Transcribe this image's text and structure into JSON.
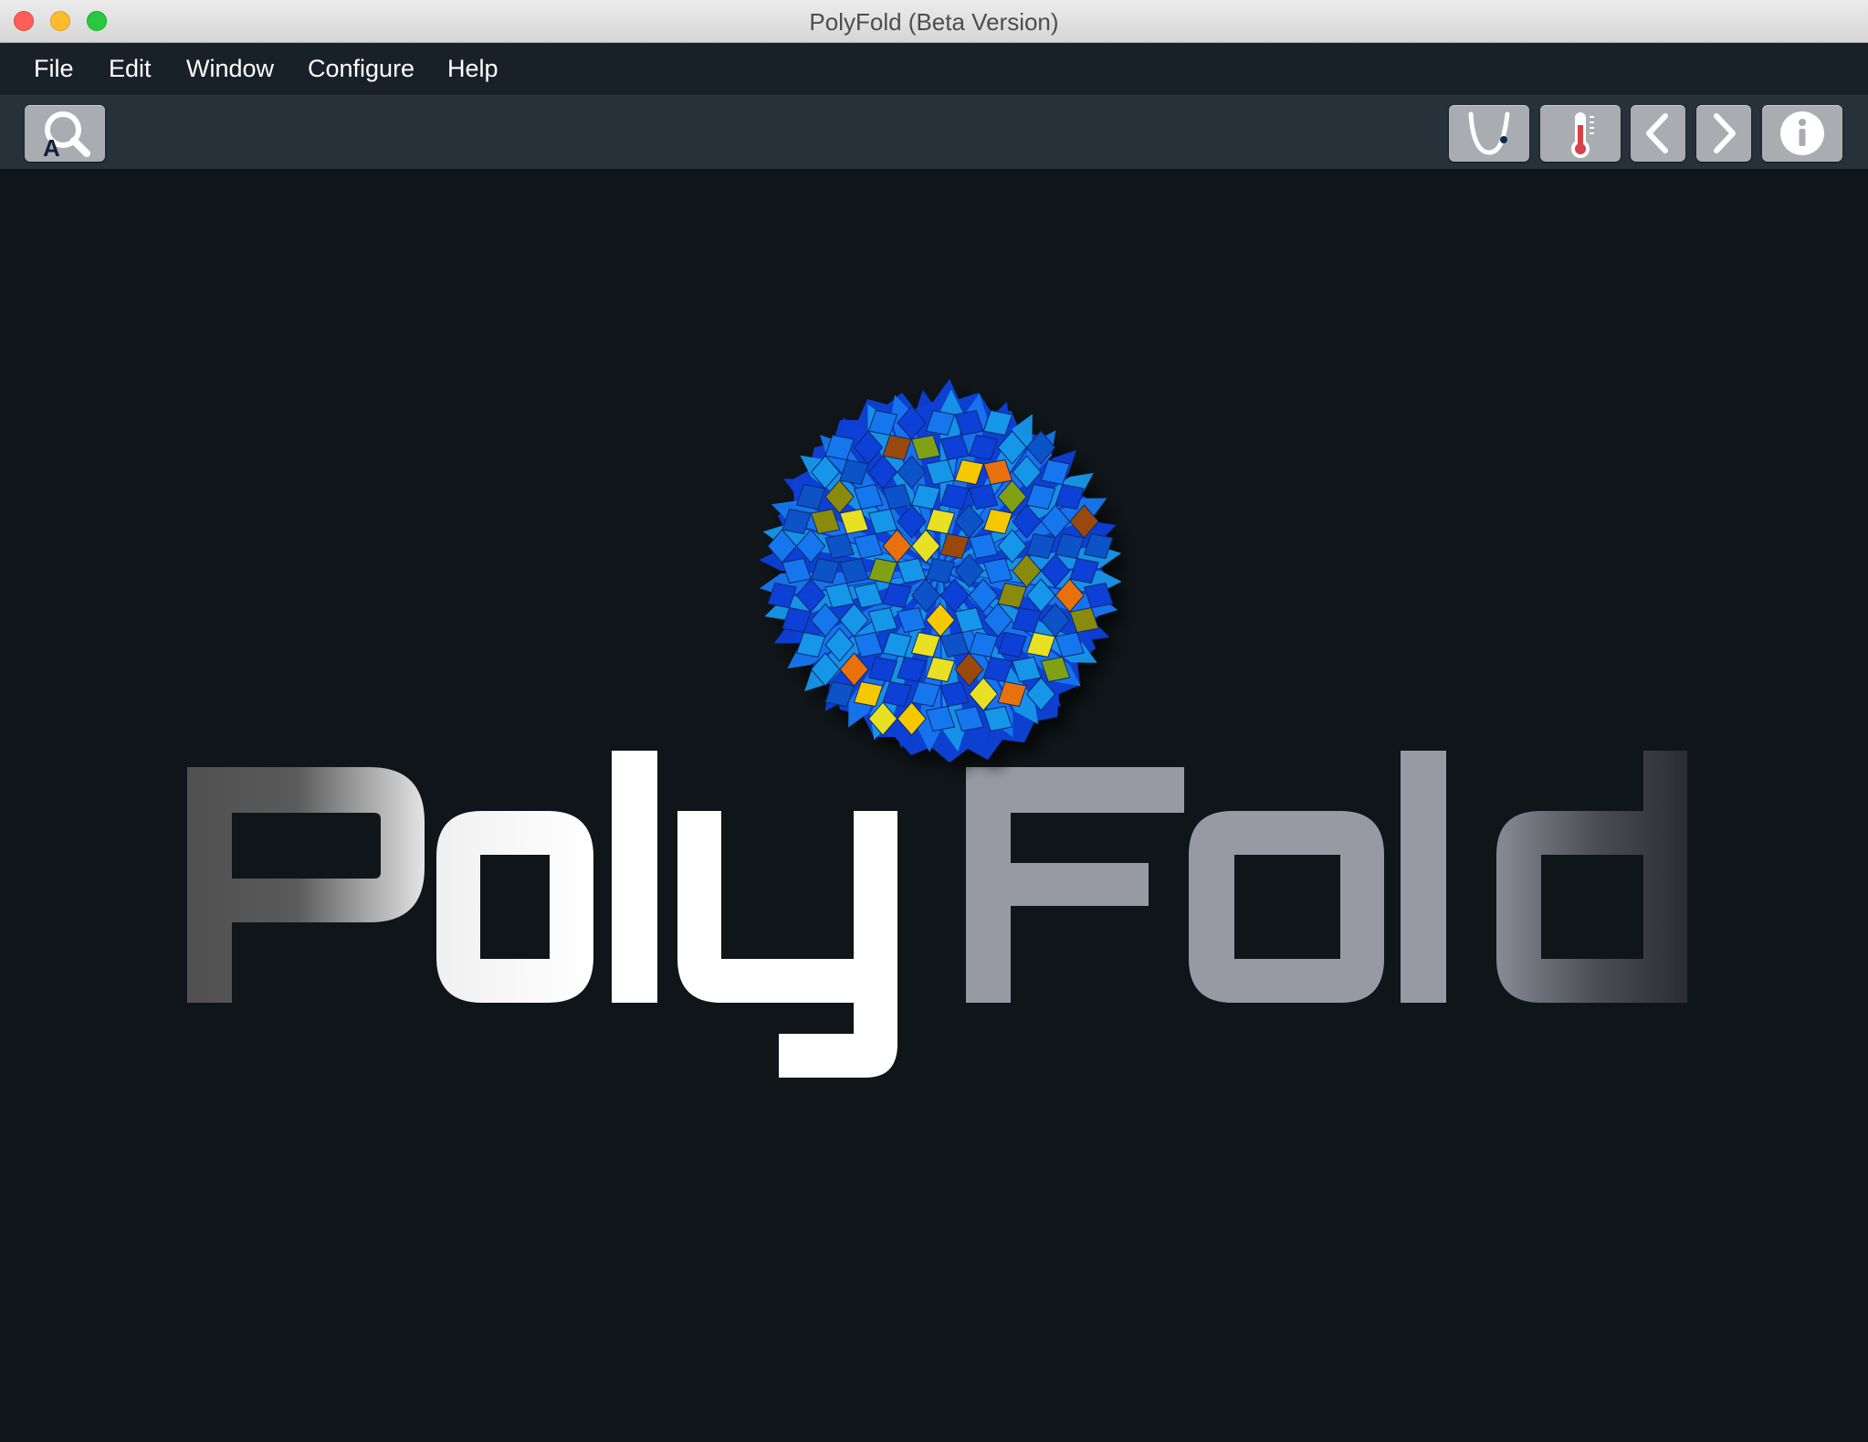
{
  "window": {
    "title": "PolyFold (Beta Version)"
  },
  "menu": {
    "items": [
      {
        "label": "File"
      },
      {
        "label": "Edit"
      },
      {
        "label": "Window"
      },
      {
        "label": "Configure"
      },
      {
        "label": "Help"
      }
    ]
  },
  "toolbar": {
    "left_buttons": [
      {
        "icon": "analyze-search-icon",
        "glyph_letter": "A"
      }
    ],
    "right_buttons": [
      {
        "icon": "energy-curve-icon"
      },
      {
        "icon": "thermometer-icon"
      },
      {
        "icon": "chevron-left-icon"
      },
      {
        "icon": "chevron-right-icon"
      },
      {
        "icon": "info-icon"
      }
    ]
  },
  "logo": {
    "word_part_1": "Poly",
    "word_part_2": "Fold",
    "colors": {
      "poly": "#ffffff",
      "fold": "#979aa5",
      "fade_dark": "#2a2c30",
      "background": "#0f1518"
    },
    "sphere_tile_colors": [
      "#0a3fd6",
      "#1476ee",
      "#1596e8",
      "#0c52c8",
      "#e8e020",
      "#f5c800",
      "#e8700a",
      "#9a4a08",
      "#8a8a10",
      "#80a018"
    ]
  },
  "colors": {
    "titlebar": "#e3e3e3",
    "menubar": "#18212a",
    "toolbar": "#26313a",
    "button": "#a9adb1",
    "content_bg": "#0f1518"
  }
}
